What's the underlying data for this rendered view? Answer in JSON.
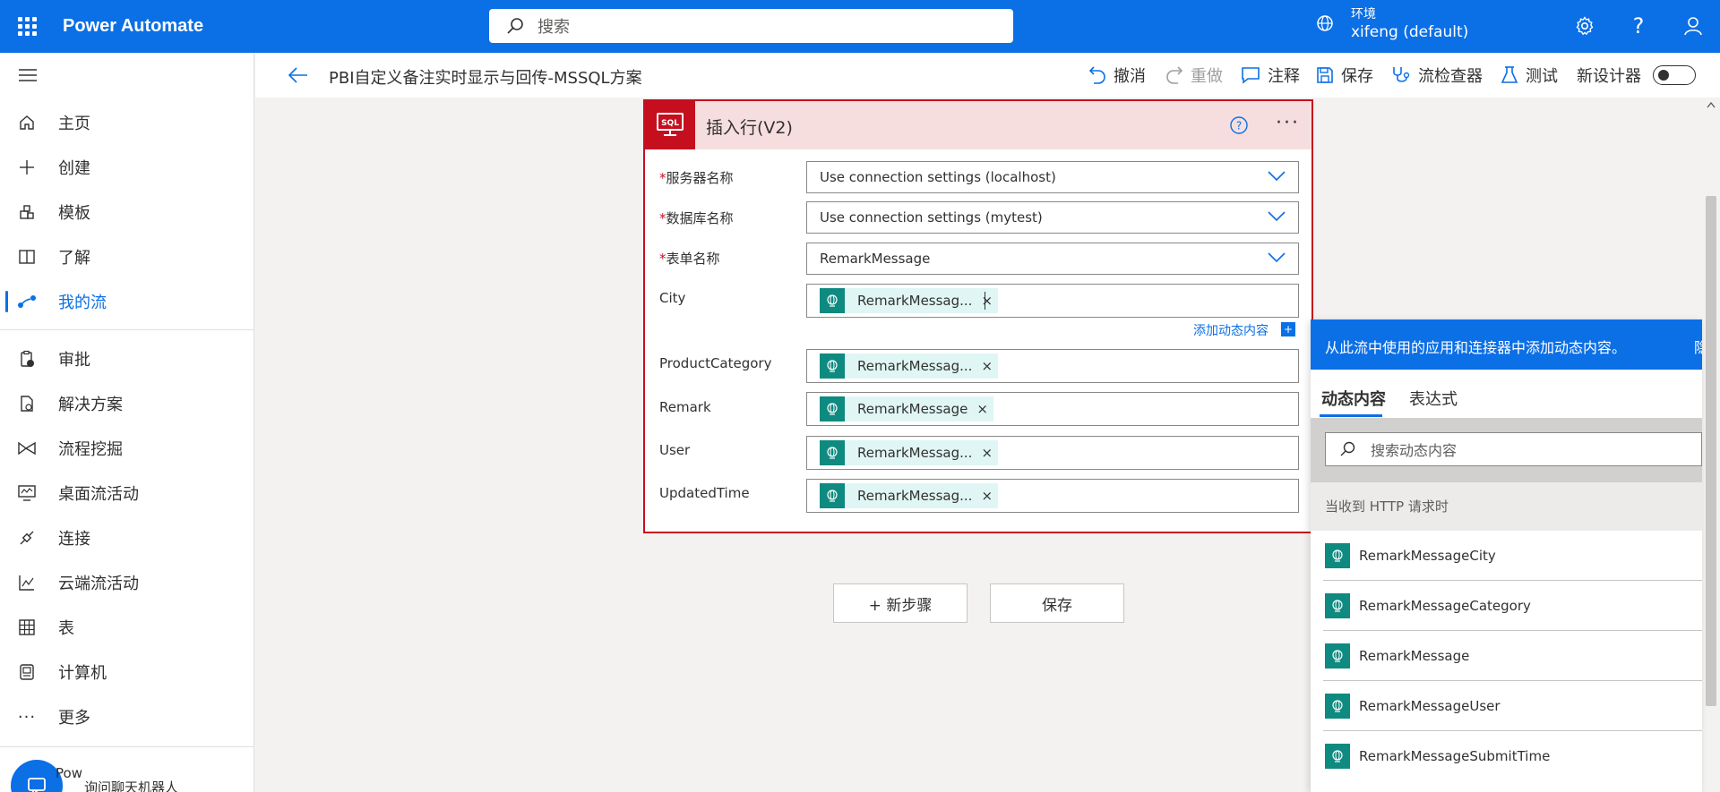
{
  "topbar": {
    "app_title": "Power Automate",
    "search_placeholder": "搜索",
    "env_label": "环境",
    "env_name": "xifeng (default)"
  },
  "sidebar": {
    "items": [
      {
        "label": "主页",
        "icon": "home-icon"
      },
      {
        "label": "创建",
        "icon": "plus-icon"
      },
      {
        "label": "模板",
        "icon": "template-icon"
      },
      {
        "label": "了解",
        "icon": "book-icon"
      },
      {
        "label": "我的流",
        "icon": "flow-icon",
        "active": true
      },
      {
        "label": "审批",
        "icon": "approval-icon"
      },
      {
        "label": "解决方案",
        "icon": "solution-icon"
      },
      {
        "label": "流程挖掘",
        "icon": "process-mining-icon"
      },
      {
        "label": "桌面流活动",
        "icon": "desktop-flow-icon"
      },
      {
        "label": "连接",
        "icon": "connection-icon"
      },
      {
        "label": "云端流活动",
        "icon": "cloud-flow-icon"
      },
      {
        "label": "表",
        "icon": "table-icon"
      },
      {
        "label": "计算机",
        "icon": "computer-icon"
      },
      {
        "label": "更多",
        "icon": "more-icon"
      }
    ],
    "chatbot_line1": "Pow",
    "chatbot_line2": "询问聊天机器人"
  },
  "cmdbar": {
    "flow_title": "PBI自定义备注实时显示与回传-MSSQL方案",
    "undo": "撤消",
    "redo": "重做",
    "comment": "注释",
    "save": "保存",
    "checker": "流检查器",
    "test": "测试",
    "new_designer": "新设计器"
  },
  "card": {
    "title": "插入行(V2)",
    "sql_badge": "SQL",
    "fields": {
      "server_label": "服务器名称",
      "server_value": "Use connection settings (localhost)",
      "db_label": "数据库名称",
      "db_value": "Use connection settings (mytest)",
      "table_label": "表单名称",
      "table_value": "RemarkMessage",
      "city_label": "City",
      "city_token": "RemarkMessag...",
      "category_label": "ProductCategory",
      "category_token": "RemarkMessag...",
      "remark_label": "Remark",
      "remark_token": "RemarkMessage",
      "user_label": "User",
      "user_token": "RemarkMessag...",
      "updated_label": "UpdatedTime",
      "updated_token": "RemarkMessag..."
    },
    "add_dynamic": "添加动态内容",
    "token_remove": "×"
  },
  "buttons": {
    "new_step": "+ 新步骤",
    "save": "保存"
  },
  "panel": {
    "header": "从此流中使用的应用和连接器中添加动态内容。",
    "header_cut": "隐",
    "tab_dynamic": "动态内容",
    "tab_expression": "表达式",
    "search_placeholder": "搜索动态内容",
    "section": "当收到 HTTP 请求时",
    "items": [
      "RemarkMessageCity",
      "RemarkMessageCategory",
      "RemarkMessage",
      "RemarkMessageUser",
      "RemarkMessageSubmitTime"
    ]
  },
  "colors": {
    "brand": "#0b6fe6",
    "card_border": "#c50f1f",
    "token": "#0e8a80"
  }
}
